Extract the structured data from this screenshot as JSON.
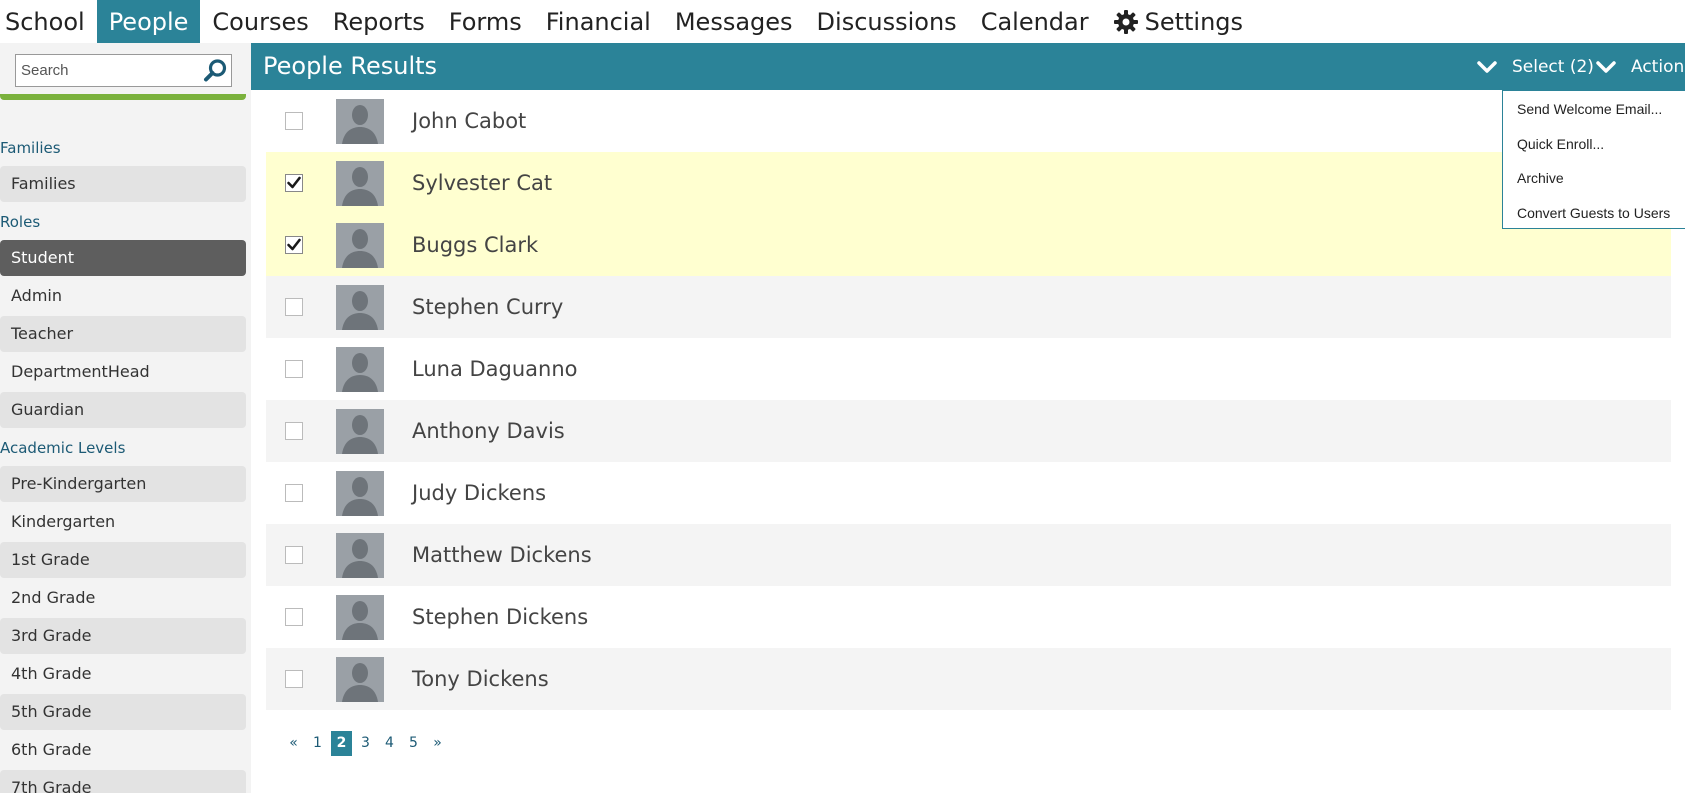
{
  "nav": {
    "items": [
      "School",
      "People",
      "Courses",
      "Reports",
      "Forms",
      "Financial",
      "Messages",
      "Discussions",
      "Calendar"
    ],
    "active_index": 1,
    "settings_label": "Settings"
  },
  "sidebar": {
    "search_placeholder": "Search",
    "sections": [
      {
        "label": "Families",
        "items": [
          {
            "label": "Families",
            "style": "alt"
          }
        ]
      },
      {
        "label": "Roles",
        "items": [
          {
            "label": "Student",
            "style": "selected"
          },
          {
            "label": "Admin",
            "style": ""
          },
          {
            "label": "Teacher",
            "style": "alt"
          },
          {
            "label": "DepartmentHead",
            "style": ""
          },
          {
            "label": "Guardian",
            "style": "alt"
          }
        ]
      },
      {
        "label": "Academic Levels",
        "items": [
          {
            "label": "Pre-Kindergarten",
            "style": "alt"
          },
          {
            "label": "Kindergarten",
            "style": ""
          },
          {
            "label": "1st Grade",
            "style": "alt"
          },
          {
            "label": "2nd Grade",
            "style": ""
          },
          {
            "label": "3rd Grade",
            "style": "alt"
          },
          {
            "label": "4th Grade",
            "style": ""
          },
          {
            "label": "5th Grade",
            "style": "alt"
          },
          {
            "label": "6th Grade",
            "style": ""
          },
          {
            "label": "7th Grade",
            "style": "alt"
          }
        ]
      }
    ]
  },
  "results": {
    "title": "People Results",
    "select_label": "Select (2)",
    "action_label": "Action",
    "action_menu": [
      "Send Welcome Email...",
      "Quick Enroll...",
      "Archive",
      "Convert Guests to Users"
    ],
    "people": [
      {
        "name": "John Cabot",
        "checked": false
      },
      {
        "name": "Sylvester Cat",
        "checked": true
      },
      {
        "name": "Buggs Clark",
        "checked": true
      },
      {
        "name": "Stephen Curry",
        "checked": false
      },
      {
        "name": "Luna Daguanno",
        "checked": false
      },
      {
        "name": "Anthony Davis",
        "checked": false
      },
      {
        "name": "Judy Dickens",
        "checked": false
      },
      {
        "name": "Matthew Dickens",
        "checked": false
      },
      {
        "name": "Stephen Dickens",
        "checked": false
      },
      {
        "name": "Tony Dickens",
        "checked": false
      }
    ]
  },
  "pagination": {
    "prev": "«",
    "pages": [
      "1",
      "2",
      "3",
      "4",
      "5"
    ],
    "current": "2",
    "next": "»"
  },
  "colors": {
    "accent": "#2b8398",
    "selected_row": "#ffffd0",
    "sidebar_selected": "#5e5e5e",
    "green": "#7ab13c"
  }
}
